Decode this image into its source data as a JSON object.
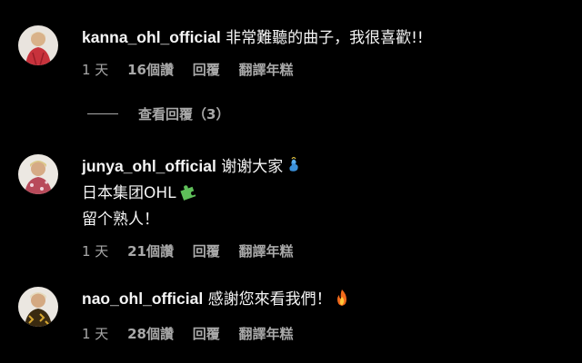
{
  "comments": [
    {
      "username": "kanna_ohl_official",
      "lines": [
        "非常難聽的曲子，我很喜歡!!"
      ],
      "emoji": [
        ""
      ],
      "time": "1 天",
      "likes": "16個讚",
      "reply_label": "回覆",
      "translate_label": "翻譯年糕",
      "avatar_color": "#c8323c"
    },
    {
      "username": "junya_ohl_official",
      "lines": [
        "谢谢大家",
        "日本集团OHL",
        "留个熟人！"
      ],
      "emoji": [
        "genie-emoji",
        "puzzle-piece-emoji",
        ""
      ],
      "time": "1 天",
      "likes": "21個讚",
      "reply_label": "回覆",
      "translate_label": "翻譯年糕",
      "avatar_color": "#b84a5a"
    },
    {
      "username": "nao_ohl_official",
      "lines": [
        "感謝您來看我們！"
      ],
      "emoji": [
        "fire-emoji"
      ],
      "time": "1 天",
      "likes": "28個讚",
      "reply_label": "回覆",
      "translate_label": "翻譯年糕",
      "avatar_color": "#8a6a2a"
    }
  ],
  "view_replies": {
    "label": "查看回覆（3）"
  },
  "colors": {
    "background": "#000000",
    "text_primary": "#f5f5f5",
    "text_secondary": "#a8a8a8"
  }
}
